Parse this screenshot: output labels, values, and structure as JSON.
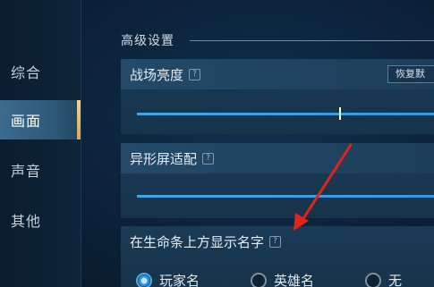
{
  "sidebar": {
    "items": [
      {
        "label": "综合",
        "active": false
      },
      {
        "label": "画面",
        "active": true
      },
      {
        "label": "声音",
        "active": false
      },
      {
        "label": "其他",
        "active": false
      }
    ]
  },
  "section": {
    "title": "高级设置"
  },
  "brightness": {
    "title": "战场亮度",
    "help": "?",
    "reset_label": "恢复默",
    "level": 0.68
  },
  "notch": {
    "title": "异形屏适配",
    "help": "?"
  },
  "name_display": {
    "title": "在生命条上方显示名字",
    "help": "?",
    "options": [
      {
        "label": "玩家名",
        "selected": true
      },
      {
        "label": "英雄名",
        "selected": false
      },
      {
        "label": "无",
        "selected": false
      }
    ]
  },
  "colors": {
    "accent": "#3fa6ea",
    "arrow": "#e2231a",
    "active_bar": "#f7d48b"
  }
}
